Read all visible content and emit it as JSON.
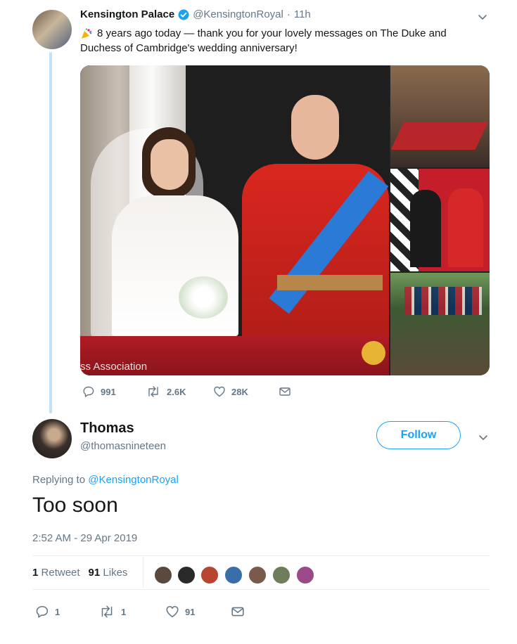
{
  "quoted_tweet": {
    "display_name": "Kensington Palace",
    "handle": "@KensingtonRoyal",
    "time_sep": "·",
    "time": "11h",
    "text_line1": "8 years ago today — thank you for your lovely messages on The Duke and",
    "text_line2": "Duchess of Cambridge's wedding anniversary!",
    "photo_caption": "ss Association",
    "stats": {
      "replies": "991",
      "retweets": "2.6K",
      "likes": "28K"
    }
  },
  "main_tweet": {
    "display_name": "Thomas",
    "handle": "@thomasnineteen",
    "follow_label": "Follow",
    "replying_prefix": "Replying to ",
    "replying_to": "@KensingtonRoyal",
    "text": "Too soon",
    "timestamp": "2:52 AM - 29 Apr 2019",
    "retweet_count": "1",
    "retweet_label": "Retweet",
    "like_count": "91",
    "like_label": "Likes",
    "actions": {
      "replies": "1",
      "retweets": "1",
      "likes": "91"
    }
  },
  "colors": {
    "accent": "#1da1f2",
    "muted": "#657786",
    "thread_line": "#c4e2f6"
  },
  "icons": [
    "verified-badge-icon",
    "chevron-down-icon",
    "reply-icon",
    "retweet-icon",
    "heart-icon",
    "message-icon",
    "confetti-emoji-icon"
  ]
}
